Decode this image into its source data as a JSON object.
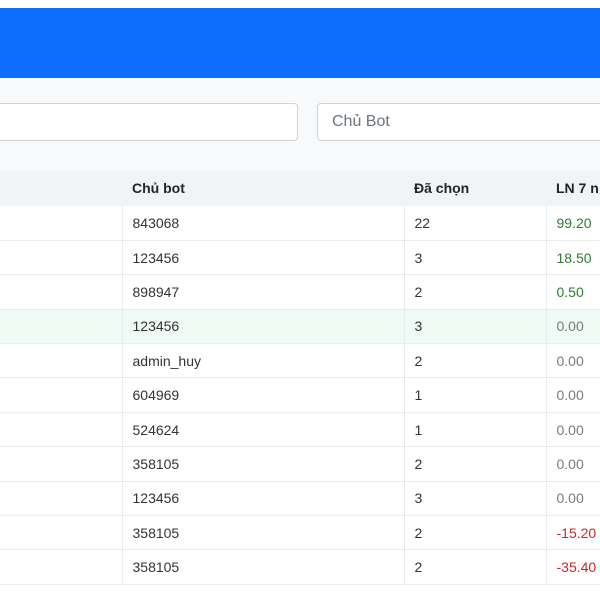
{
  "filters": {
    "search_placeholder": "",
    "owner_placeholder": "Chủ Bot"
  },
  "table": {
    "headers": {
      "owner": "Chủ bot",
      "selected": "Đã chọn",
      "profit": "LN 7 n"
    },
    "rows": [
      {
        "owner": "843068",
        "selected": "22",
        "profit": "99.20",
        "trend": "positive"
      },
      {
        "owner": "123456",
        "selected": "3",
        "profit": "18.50",
        "trend": "positive"
      },
      {
        "owner": "898947",
        "selected": "2",
        "profit": "0.50",
        "trend": "positive"
      },
      {
        "owner": "123456",
        "selected": "3",
        "profit": "0.00",
        "trend": "zero",
        "highlighted": true
      },
      {
        "owner": "admin_huy",
        "selected": "2",
        "profit": "0.00",
        "trend": "zero"
      },
      {
        "owner": "604969",
        "selected": "1",
        "profit": "0.00",
        "trend": "zero"
      },
      {
        "owner": "524624",
        "selected": "1",
        "profit": "0.00",
        "trend": "zero"
      },
      {
        "owner": "358105",
        "selected": "2",
        "profit": "0.00",
        "trend": "zero"
      },
      {
        "owner": "123456",
        "selected": "3",
        "profit": "0.00",
        "trend": "zero"
      },
      {
        "owner": "358105",
        "selected": "2",
        "profit": "-15.20",
        "trend": "negative"
      },
      {
        "owner": "358105",
        "selected": "2",
        "profit": "-35.40",
        "trend": "negative"
      }
    ]
  },
  "colors": {
    "header": "#0d6efd",
    "positive": "#2e7d32",
    "negative": "#c62828",
    "zero": "#7a7a7a",
    "highlight_row": "#eefaf3"
  }
}
